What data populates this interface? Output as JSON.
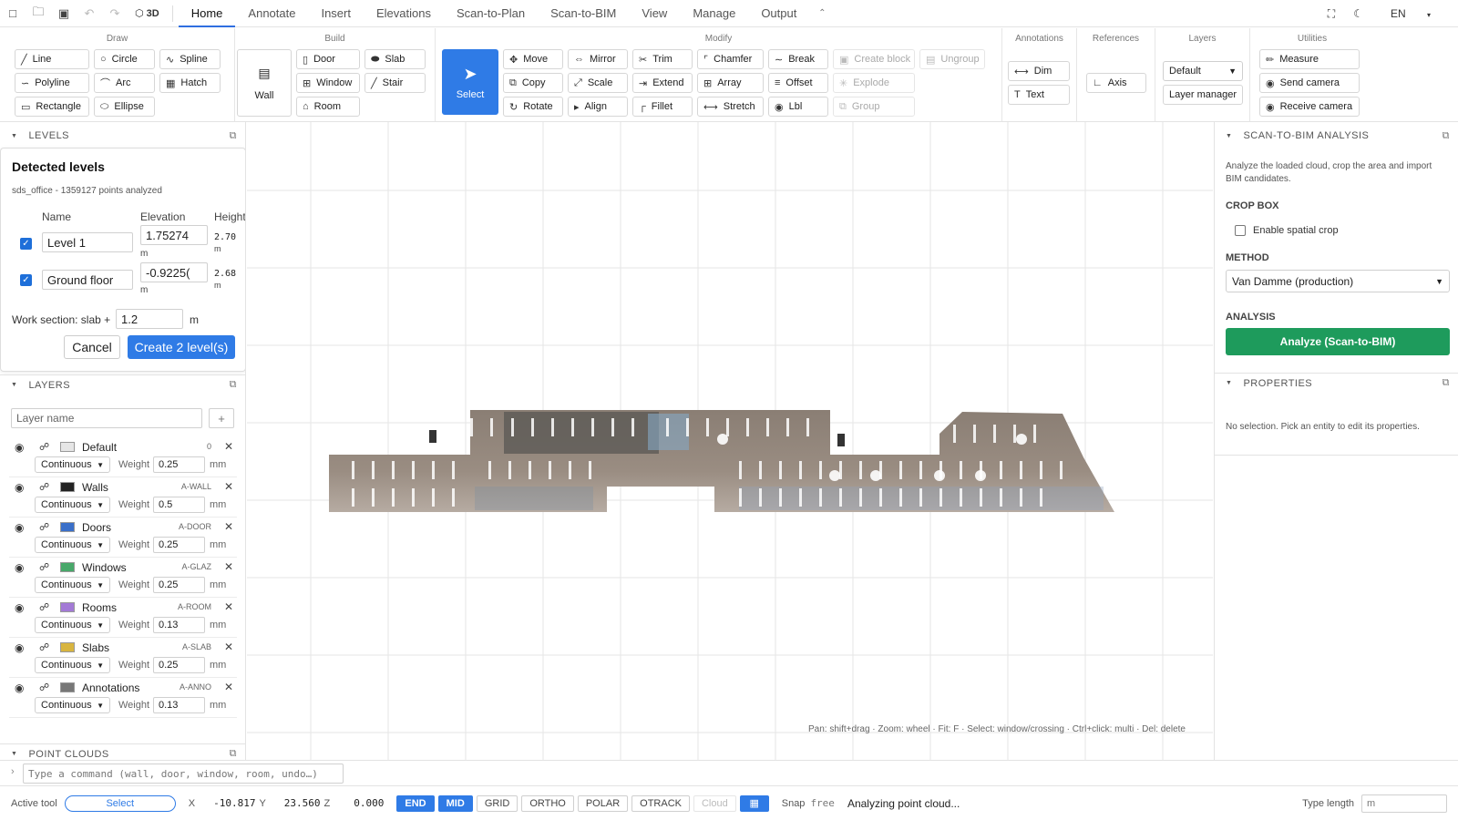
{
  "topbar": {
    "label_3d": "3D",
    "tabs": [
      "Home",
      "Annotate",
      "Insert",
      "Elevations",
      "Scan-to-Plan",
      "Scan-to-BIM",
      "View",
      "Manage",
      "Output"
    ],
    "lang": "EN"
  },
  "ribbon": {
    "draw": {
      "title": "Draw",
      "buttons": [
        "Line",
        "Circle",
        "Spline",
        "Polyline",
        "Arc",
        "Hatch",
        "Rectangle",
        "Ellipse"
      ]
    },
    "build": {
      "title": "Build",
      "wall": "Wall",
      "buttons": [
        "Door",
        "Slab",
        "Window",
        "Stair",
        "Room"
      ]
    },
    "select": "Select",
    "modify": {
      "title": "Modify",
      "buttons": [
        "Move",
        "Mirror",
        "Trim",
        "Chamfer",
        "Break",
        "Create block",
        "Ungroup",
        "Copy",
        "Scale",
        "Extend",
        "Array",
        "Offset",
        "Explode",
        "Rotate",
        "Align",
        "Fillet",
        "Stretch",
        "Lbl",
        "Group"
      ]
    },
    "annotations": {
      "title": "Annotations",
      "buttons": [
        "Dim",
        "Text"
      ]
    },
    "references": {
      "title": "References",
      "buttons": [
        "Axis"
      ]
    },
    "layers": {
      "title": "Layers",
      "select": "Default",
      "manager": "Layer manager"
    },
    "utilities": {
      "title": "Utilities",
      "buttons": [
        "Measure",
        "Send camera",
        "Receive camera"
      ]
    }
  },
  "levels": {
    "header": "LEVELS",
    "title": "Detected levels",
    "subtitle": "sds_office - 1359127 points analyzed",
    "cols": [
      "Name",
      "Elevation",
      "Height"
    ],
    "rows": [
      {
        "name": "Level 1",
        "elevation": "1.75274",
        "height": "2.70",
        "unit": "m"
      },
      {
        "name": "Ground floor",
        "elevation": "-0.9225(",
        "height": "2.68",
        "unit": "m"
      }
    ],
    "work_label": "Work section: slab +",
    "work_value": "1.2",
    "work_unit": "m",
    "cancel": "Cancel",
    "create": "Create 2 level(s)"
  },
  "layers": {
    "header": "LAYERS",
    "placeholder": "Layer name",
    "add": "+",
    "weight_label": "Weight",
    "unit": "mm",
    "items": [
      {
        "name": "Default",
        "code": "0",
        "line": "Continuous",
        "weight": "0.25",
        "color": "#e6e6e6"
      },
      {
        "name": "Walls",
        "code": "A-WALL",
        "line": "Continuous",
        "weight": "0.5",
        "color": "#222222"
      },
      {
        "name": "Doors",
        "code": "A-DOOR",
        "line": "Continuous",
        "weight": "0.25",
        "color": "#3a6fc9"
      },
      {
        "name": "Windows",
        "code": "A-GLAZ",
        "line": "Continuous",
        "weight": "0.25",
        "color": "#48a86a"
      },
      {
        "name": "Rooms",
        "code": "A-ROOM",
        "line": "Continuous",
        "weight": "0.13",
        "color": "#a37ad6"
      },
      {
        "name": "Slabs",
        "code": "A-SLAB",
        "line": "Continuous",
        "weight": "0.25",
        "color": "#d8b540"
      },
      {
        "name": "Annotations",
        "code": "A-ANNO",
        "line": "Continuous",
        "weight": "0.13",
        "color": "#777777"
      }
    ]
  },
  "point_clouds_header": "POINT CLOUDS",
  "canvas": {
    "hint": "Pan: shift+drag · Zoom: wheel · Fit: F · Select: window/crossing · Ctrl+click: multi · Del: delete"
  },
  "right": {
    "header": "SCAN-TO-BIM ANALYSIS",
    "desc": "Analyze the loaded cloud, crop the area and import BIM candidates.",
    "crop_title": "CROP BOX",
    "crop_label": "Enable spatial crop",
    "method_title": "METHOD",
    "method_value": "Van Damme (production)",
    "analysis_title": "ANALYSIS",
    "analyze_btn": "Analyze (Scan-to-BIM)",
    "props_header": "PROPERTIES",
    "props_text": "No selection. Pick an entity to edit its properties."
  },
  "cmd": {
    "placeholder": "Type a command (wall, door, window, room, undo…)"
  },
  "status": {
    "active_tool_label": "Active tool",
    "active_tool": "Select",
    "x_label": "X",
    "x": "-10.817",
    "y_label": "Y",
    "y": "23.560",
    "z_label": "Z",
    "z": "0.000",
    "toggles": [
      "END",
      "MID",
      "GRID",
      "ORTHO",
      "POLAR",
      "OTRACK",
      "Cloud"
    ],
    "snap_label": "Snap",
    "snap_value": "free",
    "message": "Analyzing point cloud...",
    "type_length_label": "Type length",
    "type_length_value": "m"
  }
}
